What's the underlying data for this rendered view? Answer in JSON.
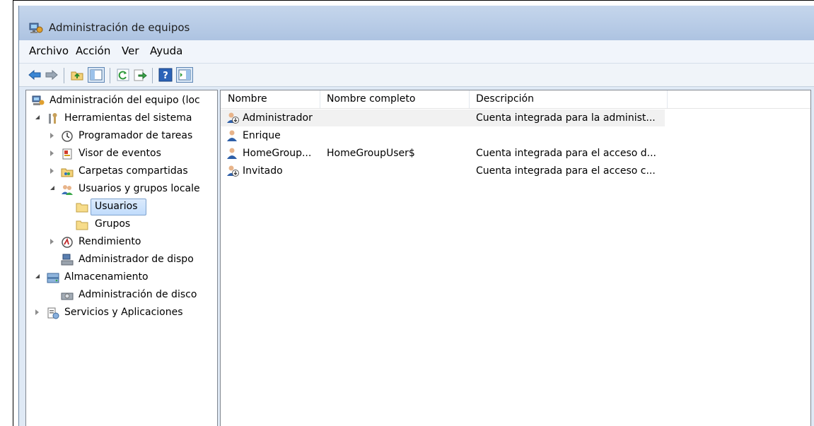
{
  "window": {
    "title": "Administración de equipos"
  },
  "menu": [
    "Archivo",
    "Acción",
    "Ver",
    "Ayuda"
  ],
  "tree": {
    "root": "Administración del equipo (loc",
    "system_tools": "Herramientas del sistema",
    "task_scheduler": "Programador de tareas",
    "event_viewer": "Visor de eventos",
    "shared_folders": "Carpetas compartidas",
    "local_users_groups": "Usuarios y grupos locale",
    "users": "Usuarios",
    "groups": "Grupos",
    "performance": "Rendimiento",
    "device_manager": "Administrador de dispo",
    "storage": "Almacenamiento",
    "disk_management": "Administración de disco",
    "services_apps": "Servicios y Aplicaciones"
  },
  "table": {
    "columns": [
      "Nombre",
      "Nombre completo",
      "Descripción"
    ],
    "rows": [
      {
        "name": "Administrador",
        "full_name": "",
        "description": "Cuenta integrada para la administ..."
      },
      {
        "name": "Enrique",
        "full_name": "",
        "description": ""
      },
      {
        "name": "HomeGroup...",
        "full_name": "HomeGroupUser$",
        "description": "Cuenta integrada para el acceso d..."
      },
      {
        "name": "Invitado",
        "full_name": "",
        "description": "Cuenta integrada para el acceso c..."
      }
    ]
  },
  "icons": {
    "back": "arrow-left-icon",
    "forward": "arrow-right-icon",
    "up": "folder-up-icon",
    "show_hide_tree": "console-tree-icon",
    "refresh": "refresh-icon",
    "export": "export-list-icon",
    "help": "help-icon",
    "action_pane": "action-pane-icon"
  },
  "colors": {
    "accent": "#3b78c4",
    "selection": "#c1dcfc",
    "titlebar": "#b7cbe6"
  }
}
